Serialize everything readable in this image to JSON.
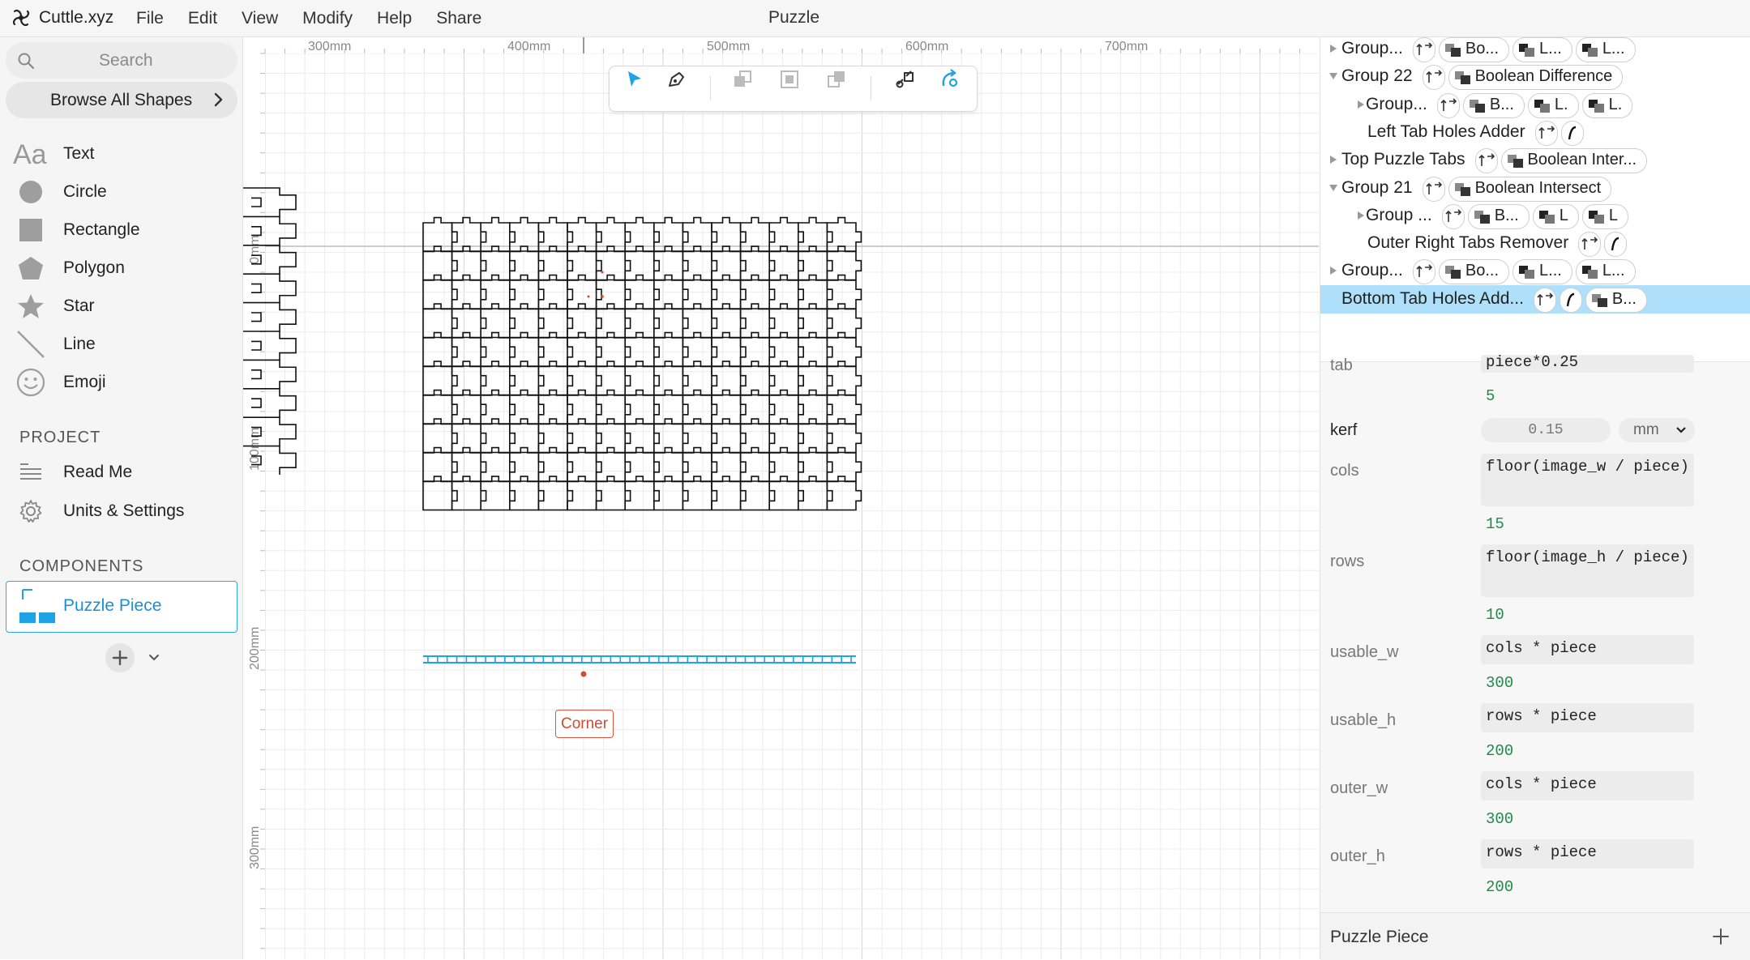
{
  "app": {
    "name": "Cuttle.xyz",
    "document_title": "Puzzle"
  },
  "menu": [
    "File",
    "Edit",
    "View",
    "Modify",
    "Help",
    "Share"
  ],
  "sidebar": {
    "search_placeholder": "Search",
    "browse_label": "Browse All Shapes",
    "shapes": [
      {
        "label": "Text",
        "icon": "text-icon"
      },
      {
        "label": "Circle",
        "icon": "circle-icon"
      },
      {
        "label": "Rectangle",
        "icon": "rectangle-icon"
      },
      {
        "label": "Polygon",
        "icon": "polygon-icon"
      },
      {
        "label": "Star",
        "icon": "star-icon"
      },
      {
        "label": "Line",
        "icon": "line-icon"
      },
      {
        "label": "Emoji",
        "icon": "emoji-icon"
      }
    ],
    "project_heading": "PROJECT",
    "project_items": [
      {
        "label": "Read Me",
        "icon": "document-icon"
      },
      {
        "label": "Units & Settings",
        "icon": "gear-icon"
      }
    ],
    "components_heading": "COMPONENTS",
    "components": [
      {
        "label": "Puzzle Piece",
        "selected": true
      }
    ]
  },
  "canvas": {
    "ruler_top": [
      "300mm",
      "400mm",
      "500mm",
      "600mm",
      "700mm"
    ],
    "ruler_left": [
      "0mm",
      "100mm",
      "200mm",
      "300mm"
    ],
    "corner_label": "Corner",
    "puzzle_cols": 15,
    "puzzle_rows": 10,
    "side_strip_rows": 10,
    "colors": {
      "grid_minor": "#ececec",
      "grid_major": "#d6d6d6",
      "selection": "#1fa3e6",
      "corner": "#d44a30",
      "ink": "#111111"
    }
  },
  "toolbar": {
    "tools": [
      "select-arrow-icon",
      "pen-icon",
      "bring-backward-icon",
      "group-icon",
      "bring-forward-icon",
      "link-icon",
      "rotate-tool-icon"
    ]
  },
  "tree": {
    "rows": [
      {
        "label": "Group...",
        "expanded": false,
        "indent": 0,
        "chips": [
          "Bo...",
          "L...",
          "L..."
        ],
        "selected": false
      },
      {
        "label": "Group 22",
        "expanded": true,
        "indent": 0,
        "chips": [
          "Boolean Difference"
        ],
        "selected": false
      },
      {
        "label": "Group...",
        "expanded": false,
        "indent": 1,
        "chips": [
          "B...",
          "L.",
          "L."
        ],
        "selected": false
      },
      {
        "label": "Left Tab Holes Adder",
        "expanded": null,
        "indent": 2,
        "chips": [],
        "selected": false
      },
      {
        "label": "Top Puzzle Tabs",
        "expanded": false,
        "indent": 0,
        "chips": [
          "Boolean Inter..."
        ],
        "selected": false
      },
      {
        "label": "Group 21",
        "expanded": true,
        "indent": 0,
        "chips": [
          "Boolean Intersect"
        ],
        "selected": false
      },
      {
        "label": "Group ...",
        "expanded": false,
        "indent": 1,
        "chips": [
          "B...",
          "L",
          "L"
        ],
        "selected": false
      },
      {
        "label": "Outer Right Tabs Remover",
        "expanded": null,
        "indent": 2,
        "chips": [],
        "selected": false
      },
      {
        "label": "Group...",
        "expanded": false,
        "indent": 0,
        "chips": [
          "Bo...",
          "L...",
          "L..."
        ],
        "selected": false
      },
      {
        "label": "Bottom Tab Holes Add...",
        "expanded": null,
        "indent": 0,
        "chips": [
          "B..."
        ],
        "selected": true
      }
    ]
  },
  "params": {
    "tab": {
      "label": "tab",
      "expr": "piece*0.25",
      "value": "5"
    },
    "kerf": {
      "label": "kerf",
      "value": "0.15",
      "unit": "mm"
    },
    "cols": {
      "label": "cols",
      "expr": "floor(image_w / piece)",
      "value": "15"
    },
    "rows": {
      "label": "rows",
      "expr": "floor(image_h / piece)",
      "value": "10"
    },
    "usable_w": {
      "label": "usable_w",
      "expr": "cols * piece",
      "value": "300"
    },
    "usable_h": {
      "label": "usable_h",
      "expr": "rows * piece",
      "value": "200"
    },
    "outer_w": {
      "label": "outer_w",
      "expr": "cols * piece",
      "value": "300"
    },
    "outer_h": {
      "label": "outer_h",
      "expr": "rows * piece",
      "value": "200"
    }
  },
  "footer": {
    "component_name": "Puzzle Piece"
  }
}
